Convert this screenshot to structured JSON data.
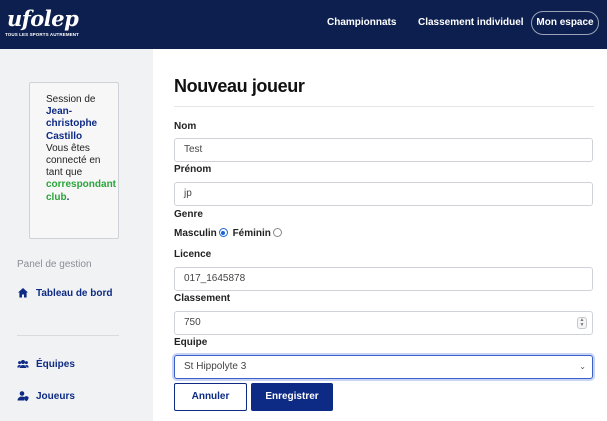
{
  "brand": {
    "logo_text": "ufolep",
    "tagline": "TOUS LES SPORTS AUTREMENT"
  },
  "nav": {
    "championnats": "Championnats",
    "classement": "Classement individuel",
    "mon_espace": "Mon espace"
  },
  "sidebar": {
    "session": {
      "prefix": "Session de",
      "name": "Jean-christophe Castillo",
      "middle": "Vous êtes connecté en tant que",
      "role": "correspondant club",
      "suffix": "."
    },
    "panel_title": "Panel de gestion",
    "items": [
      {
        "label": "Tableau de bord",
        "icon": "home-icon"
      },
      {
        "label": "Équipes",
        "icon": "users-icon"
      },
      {
        "label": "Joueurs",
        "icon": "user-shield-icon"
      }
    ]
  },
  "form": {
    "title": "Nouveau joueur",
    "nom": {
      "label": "Nom",
      "value": "Test"
    },
    "prenom": {
      "label": "Prénom",
      "value": "jp"
    },
    "genre": {
      "label": "Genre",
      "options": [
        "Masculin",
        "Féminin"
      ],
      "selected": "Masculin"
    },
    "licence": {
      "label": "Licence",
      "value": "017_1645878"
    },
    "classement": {
      "label": "Classement",
      "value": "750"
    },
    "equipe": {
      "label": "Equipe",
      "value": "St Hippolyte 3"
    },
    "cancel_label": "Annuler",
    "save_label": "Enregistrer"
  },
  "colors": {
    "navbar": "#0d1f4f",
    "primary": "#0d2a84",
    "role_green": "#2aa53a"
  }
}
